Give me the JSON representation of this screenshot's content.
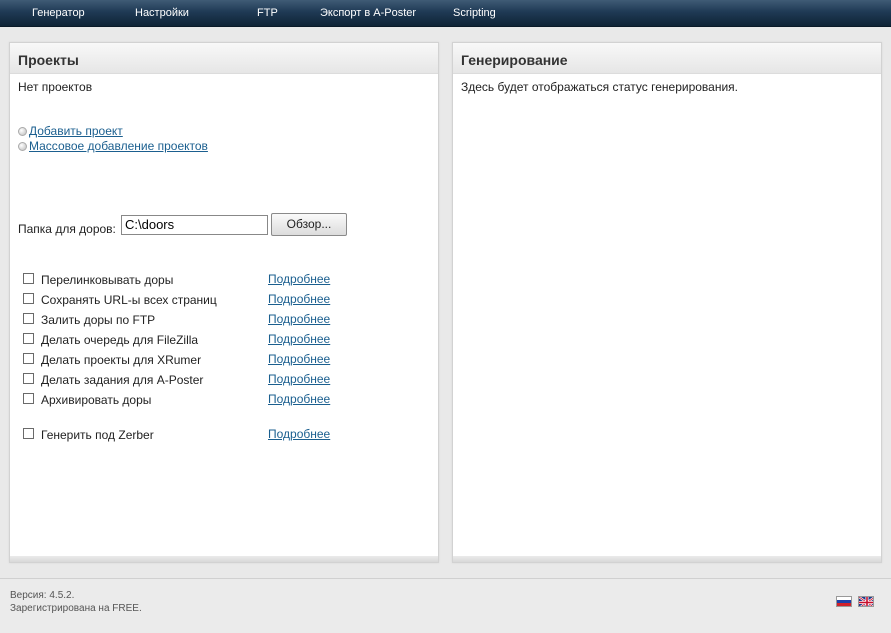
{
  "nav": {
    "items": [
      "Генератор",
      "Настройки",
      "FTP",
      "Экспорт в A-Poster",
      "Scripting"
    ]
  },
  "projects_panel": {
    "title": "Проекты",
    "empty_text": "Нет проектов",
    "add_project": "Добавить проект",
    "bulk_add": "Массовое добавление проектов",
    "folder_label": "Папка для доров:",
    "folder_value": "C:\\doors",
    "browse_button": "Обзор...",
    "options": [
      {
        "label": "Перелинковывать доры",
        "more": "Подробнее",
        "checked": false
      },
      {
        "label": "Сохранять URL-ы всех страниц",
        "more": "Подробнее",
        "checked": false
      },
      {
        "label": "Залить доры по FTP",
        "more": "Подробнее",
        "checked": false
      },
      {
        "label": "Делать очередь для FileZilla",
        "more": "Подробнее",
        "checked": false
      },
      {
        "label": "Делать проекты для XRumer",
        "more": "Подробнее",
        "checked": false
      },
      {
        "label": "Делать задания для A-Poster",
        "more": "Подробнее",
        "checked": false
      },
      {
        "label": "Архивировать доры",
        "more": "Подробнее",
        "checked": false
      },
      {
        "label": "Генерить под Zerber",
        "more": "Подробнее",
        "checked": false
      }
    ]
  },
  "generation_panel": {
    "title": "Генерирование",
    "status_text": "Здесь будет отображаться статус генерирования."
  },
  "footer": {
    "version": "Версия: 4.5.2.",
    "registration": "Зарегистрирована на FREE."
  },
  "languages": [
    "russian-flag",
    "english-flag"
  ],
  "colors": {
    "nav_bg": "#1f3a55",
    "link": "#1b5f8f"
  }
}
